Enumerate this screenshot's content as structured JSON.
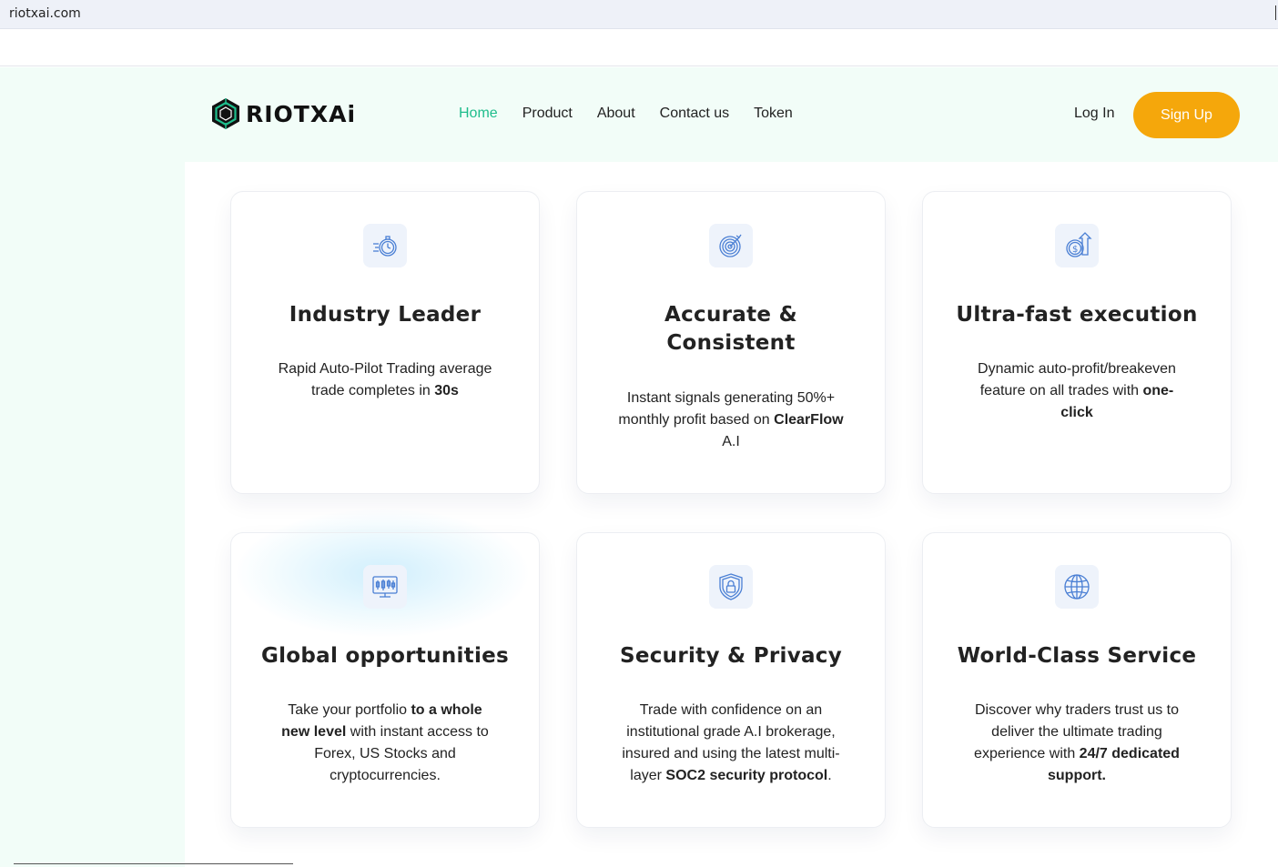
{
  "browser": {
    "url": "riotxai.com"
  },
  "header": {
    "logo_text": "RIOTXAi",
    "nav": [
      {
        "label": "Home",
        "active": true
      },
      {
        "label": "Product",
        "active": false
      },
      {
        "label": "About",
        "active": false
      },
      {
        "label": "Contact us",
        "active": false
      },
      {
        "label": "Token",
        "active": false
      }
    ],
    "login_label": "Log In",
    "signup_label": "Sign Up"
  },
  "colors": {
    "accent_green": "#1fbd8c",
    "signup_orange": "#f5a70b",
    "icon_blue": "#4a7fd4"
  },
  "features": [
    {
      "icon": "stopwatch-icon",
      "title": "Industry Leader",
      "desc": [
        {
          "t": "Rapid Auto-Pilot Trading average trade completes in "
        },
        {
          "t": "30s",
          "b": true
        }
      ]
    },
    {
      "icon": "target-icon",
      "title": "Accurate & Consistent",
      "desc": [
        {
          "t": "Instant signals generating 50%+ monthly profit based on "
        },
        {
          "t": "ClearFlow",
          "b": true
        },
        {
          "t": " A.I"
        }
      ]
    },
    {
      "icon": "dollar-growth-icon",
      "title": "Ultra-fast execution",
      "desc": [
        {
          "t": "Dynamic auto-profit/breakeven feature on all trades with "
        },
        {
          "t": "one-click",
          "b": true
        }
      ]
    },
    {
      "icon": "candlestick-monitor-icon",
      "title": "Global opportunities",
      "desc": [
        {
          "t": "Take your portfolio "
        },
        {
          "t": "to a whole new level",
          "b": true
        },
        {
          "t": " with instant access to Forex, US Stocks and cryptocurrencies."
        }
      ]
    },
    {
      "icon": "shield-lock-icon",
      "title": "Security & Privacy",
      "desc": [
        {
          "t": "Trade with confidence on an institutional grade A.I brokerage, insured and using the latest multi-layer "
        },
        {
          "t": "SOC2 security protocol",
          "b": true
        },
        {
          "t": "."
        }
      ]
    },
    {
      "icon": "globe-icon",
      "title": "World-Class Service",
      "desc": [
        {
          "t": "Discover why traders trust us to deliver the ultimate trading experience with "
        },
        {
          "t": "24/7 dedicated support.",
          "b": true
        }
      ]
    }
  ]
}
